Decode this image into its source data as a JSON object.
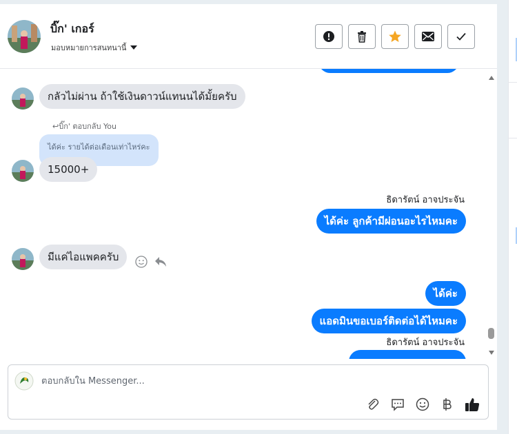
{
  "header": {
    "contact_name": "บิ๊ก' เกอร์",
    "assign_label": "มอบหมายการสนทนานี้"
  },
  "actions": [
    {
      "icon": "alert-icon"
    },
    {
      "icon": "trash-icon"
    },
    {
      "icon": "star-icon",
      "color": "#f5a623"
    },
    {
      "icon": "mail-icon"
    },
    {
      "icon": "check-icon"
    }
  ],
  "messages": {
    "m1": "กลัวไม่ผ่าน ถ้าใช้เงินดาวน์แทนนได้มั้ยครับ",
    "reply_tag": "บิ๊ก' ตอบกลับ You",
    "quoted": "ได้ค่ะ รายได้ต่อเดือนเท่าไหร่คะ",
    "m2": "15000+",
    "sender1": "ธิดารัตน์ อาจประจัน",
    "m3": "ได้ค่ะ ลูกค้ามีผ่อนอะไรไหมคะ",
    "m4": "มีแค่ไอแพคครับ",
    "m5": "ได้ค่ะ",
    "m6": "แอดมินขอเบอร์ติดต่อได้ไหมคะ",
    "sender2": "ธิดารัตน์ อาจประจัน"
  },
  "composer": {
    "placeholder": "ตอบกลับใน Messenger..."
  },
  "colors": {
    "outgoing_bubble": "#0a7cff",
    "incoming_bubble": "#e4e6eb",
    "quoted_bubble": "#d3e4fb",
    "like_icon": "#1c1e21"
  }
}
